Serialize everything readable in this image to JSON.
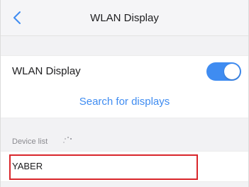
{
  "navbar": {
    "title": "WLAN Display"
  },
  "settings": {
    "wlan_display_label": "WLAN Display",
    "wlan_display_enabled": true,
    "search_label": "Search for displays"
  },
  "device_list": {
    "header": "Device list",
    "items": [
      {
        "name": "YABER"
      }
    ]
  },
  "colors": {
    "accent": "#3f8cf1",
    "highlight": "#d9262b"
  }
}
